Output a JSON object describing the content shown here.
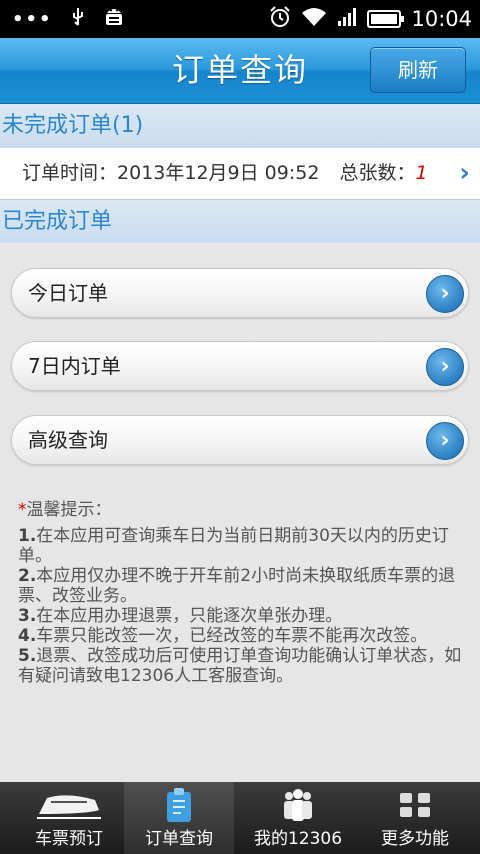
{
  "status_bar": {
    "time": "10:04"
  },
  "header": {
    "title": "订单查询",
    "refresh_label": "刷新"
  },
  "incomplete": {
    "section_title": "未完成订单(1)",
    "order_time_label": "订单时间：",
    "order_time": "2013年12月9日 09:52",
    "count_label": "总张数：",
    "count": "1"
  },
  "completed": {
    "section_title": "已完成订单",
    "buttons": [
      {
        "label": "今日订单"
      },
      {
        "label": "7日内订单"
      },
      {
        "label": "高级查询"
      }
    ]
  },
  "tips": {
    "title": "温馨提示：",
    "items": [
      {
        "num": "1.",
        "text": "在本应用可查询乘车日为当前日期前30天以内的历史订单。"
      },
      {
        "num": "2.",
        "text": "本应用仅办理不晚于开车前2小时尚未换取纸质车票的退票、改签业务。"
      },
      {
        "num": "3.",
        "text": "在本应用办理退票，只能逐次单张办理。"
      },
      {
        "num": "4.",
        "text": "车票只能改签一次，已经改签的车票不能再次改签。"
      },
      {
        "num": "5.",
        "text": "退票、改签成功后可使用订单查询功能确认订单状态，如有疑问请致电12306人工客服查询。"
      }
    ]
  },
  "tabs": [
    {
      "label": "车票预订",
      "icon": "train-icon"
    },
    {
      "label": "订单查询",
      "icon": "clipboard-icon"
    },
    {
      "label": "我的12306",
      "icon": "people-icon"
    },
    {
      "label": "更多功能",
      "icon": "more-icon"
    }
  ],
  "colors": {
    "accent": "#1d8fd4",
    "section_text": "#2a86cf",
    "count": "#d20000"
  }
}
